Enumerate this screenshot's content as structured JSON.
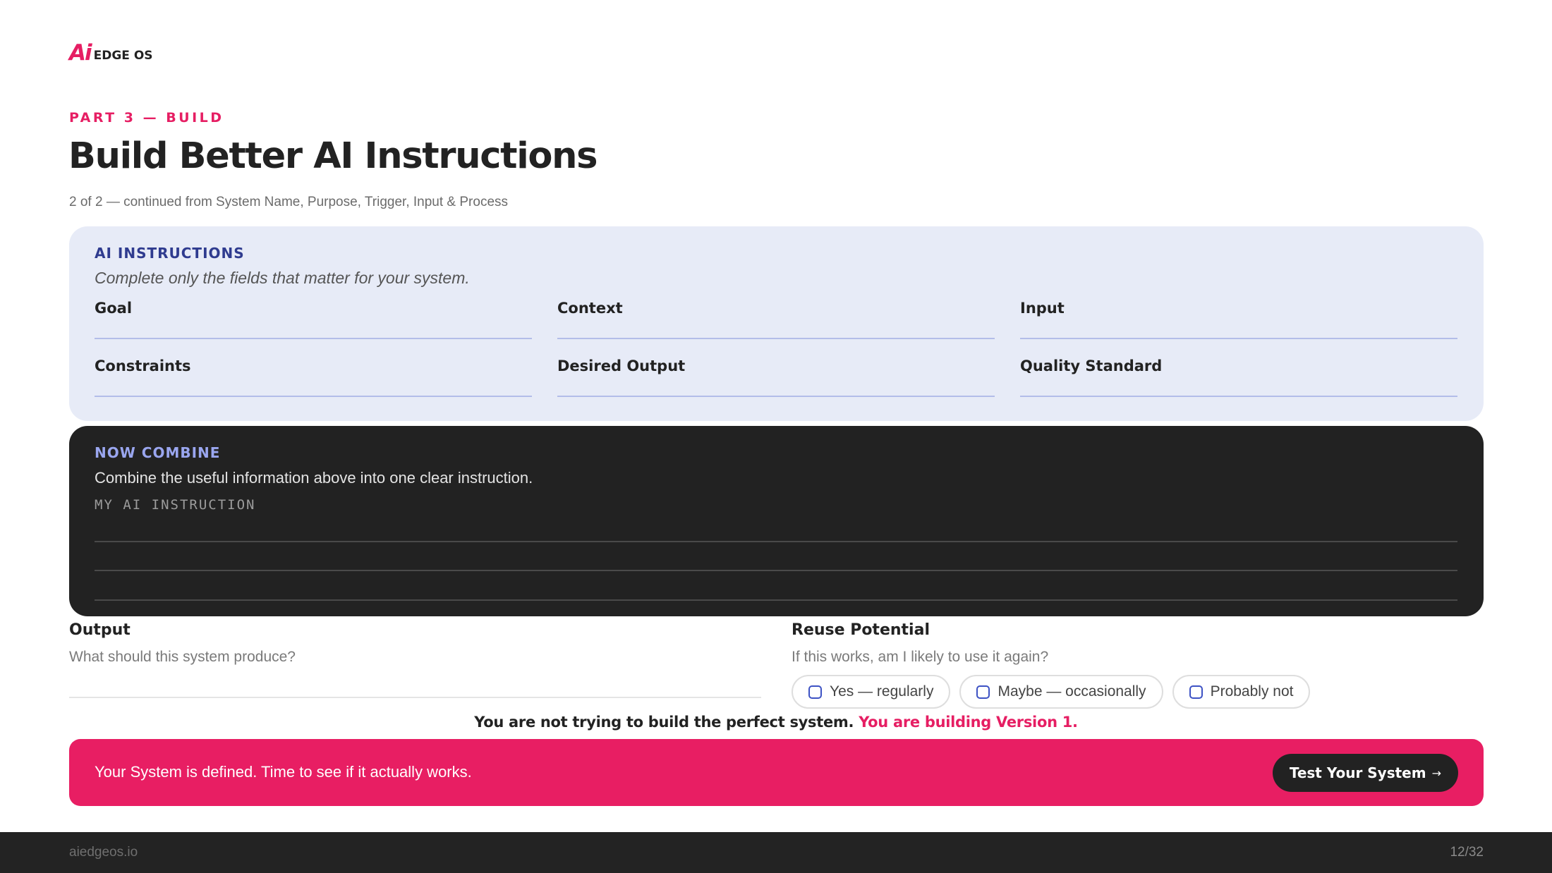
{
  "brand": {
    "logo_mark": "Ai",
    "logo_text": "EDGE OS"
  },
  "header": {
    "eyebrow": "PART 3 — BUILD",
    "title": "Build Better AI Instructions",
    "subtitle": "2 of 2 — continued from System Name, Purpose, Trigger, Input & Process"
  },
  "ai_instructions": {
    "label": "AI INSTRUCTIONS",
    "description": "Complete only the fields that matter for your system.",
    "fields": [
      "Goal",
      "Context",
      "Input",
      "Constraints",
      "Desired Output",
      "Quality Standard"
    ]
  },
  "now_combine": {
    "label": "NOW COMBINE",
    "description": "Combine the useful information above into one clear instruction.",
    "field_label": "MY AI INSTRUCTION"
  },
  "output": {
    "title": "Output",
    "description": "What should this system produce?"
  },
  "reuse": {
    "title": "Reuse Potential",
    "description": "If this works, am I likely to use it again?",
    "options": [
      "Yes — regularly",
      "Maybe — occasionally",
      "Probably not"
    ]
  },
  "tagline": {
    "main": "You are not trying to build the perfect system.",
    "accent": "You are building Version 1."
  },
  "banner": {
    "text": "Your System is defined. Time to see if it actually works.",
    "button_label": "Test Your System",
    "button_arrow": "→"
  },
  "footer": {
    "site": "aiedgeos.io",
    "page": "12/32"
  },
  "colors": {
    "accent": "#e81e63",
    "dark": "#222222",
    "panel": "#e7ebf7",
    "ai_label": "#2f3b8f",
    "combine_label": "#9aa6ef"
  }
}
